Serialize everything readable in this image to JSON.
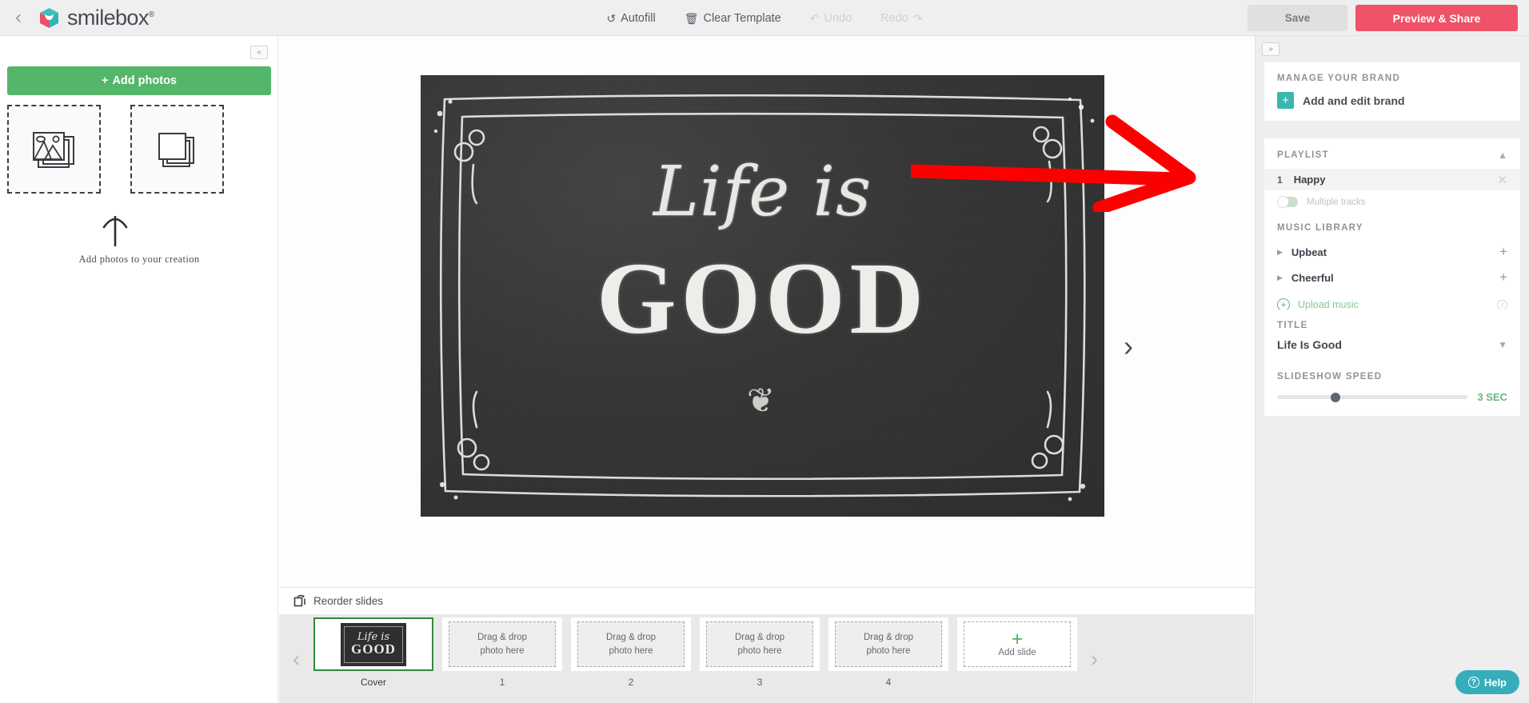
{
  "topbar": {
    "back_icon": "chevron-left-icon",
    "brand_name": "smilebox",
    "brand_reg": "®",
    "autofill": "Autofill",
    "autofill_icon": "undo-circular-icon",
    "clear_template": "Clear Template",
    "clear_icon": "trash-icon",
    "undo": "Undo",
    "undo_icon": "undo-arrow-icon",
    "redo": "Redo",
    "redo_icon": "redo-arrow-icon",
    "save": "Save",
    "preview_share": "Preview & Share",
    "accent_pink": "#ef5269",
    "save_bg": "#e0e0e0"
  },
  "left_panel": {
    "collapse_icon": "chevron-double-left-icon",
    "add_photos": "Add photos",
    "add_photos_color": "#54b669",
    "dropzones": [
      {
        "name": "photos-dropzone",
        "icon": "photo-stack-icon"
      },
      {
        "name": "blank-dropzone",
        "icon": "blank-stack-icon"
      }
    ],
    "hint_text": "Add photos to your creation",
    "hint_icon": "up-arrow-icon"
  },
  "canvas": {
    "slide_text_script": "Life is",
    "slide_text_bold": "GOOD",
    "flourish": "❦",
    "next_icon": "chevron-right-icon",
    "annotation": "red-arrow-pointing-to-playlist",
    "annotation_color": "#ff0000"
  },
  "filmstrip": {
    "reorder_label": "Reorder slides",
    "reorder_icon": "reorder-slides-icon",
    "prev_icon": "chevron-left-icon",
    "next_icon": "chevron-right-icon",
    "cover_label": "Cover",
    "slides": [
      {
        "label": "1",
        "placeholder_line1": "Drag & drop",
        "placeholder_line2": "photo here"
      },
      {
        "label": "2",
        "placeholder_line1": "Drag & drop",
        "placeholder_line2": "photo here"
      },
      {
        "label": "3",
        "placeholder_line1": "Drag & drop",
        "placeholder_line2": "photo here"
      },
      {
        "label": "4",
        "placeholder_line1": "Drag & drop",
        "placeholder_line2": "photo here"
      }
    ],
    "add_slide": "Add slide",
    "add_slide_plus": "+"
  },
  "right_panel": {
    "collapse_icon": "chevron-double-right-icon",
    "brand": {
      "heading": "MANAGE YOUR BRAND",
      "link": "Add and edit brand",
      "plus": "+",
      "plus_color": "#3bb6ae"
    },
    "playlist": {
      "heading": "PLAYLIST",
      "collapse_icon": "chevron-up-icon",
      "track_number": "1",
      "track_name": "Happy",
      "remove_icon": "close-x-icon",
      "multiple_tracks_label": "Multiple tracks",
      "multiple_tracks_on": false
    },
    "music_library": {
      "heading": "MUSIC LIBRARY",
      "categories": [
        {
          "name": "Upbeat",
          "expand_icon": "triangle-right-icon",
          "add_icon": "plus-icon"
        },
        {
          "name": "Cheerful",
          "expand_icon": "triangle-right-icon",
          "add_icon": "plus-icon"
        }
      ],
      "upload_label": "Upload music",
      "upload_icon": "circle-plus-icon",
      "info_icon": "info-icon"
    },
    "title": {
      "heading": "TITLE",
      "value": "Life Is Good",
      "dropdown_icon": "chevron-down-icon"
    },
    "speed": {
      "heading": "SLIDESHOW SPEED",
      "value": "3 SEC",
      "value_color": "#68b87d",
      "slider_position_percent": 28
    }
  },
  "help": {
    "label": "Help",
    "icon": "question-mark-icon",
    "color": "#35aeba"
  }
}
